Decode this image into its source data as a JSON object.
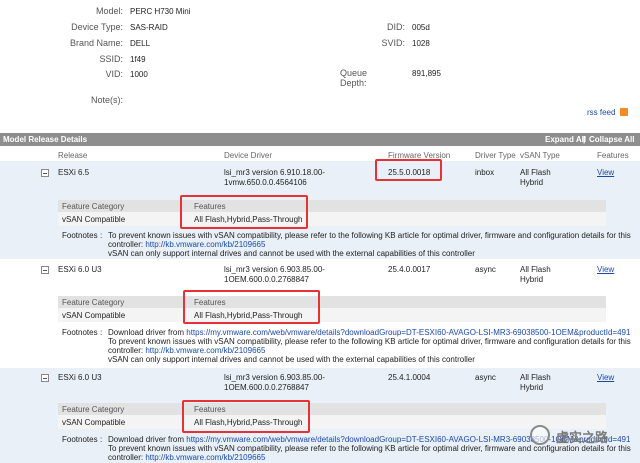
{
  "device": {
    "model_label": "Model:",
    "model": "PERC H730 Mini",
    "type_label": "Device Type:",
    "type": "SAS-RAID",
    "brand_label": "Brand Name:",
    "brand": "DELL",
    "ssid_label": "SSID:",
    "ssid": "1f49",
    "vid_label": "VID:",
    "vid": "1000",
    "notes_label": "Note(s):",
    "did_label": "DID:",
    "did": "005d",
    "svid_label": "SVID:",
    "svid": "1028",
    "queue_label_1": "Queue",
    "queue_label_2": "Depth:",
    "queue": "891,895",
    "rss": "rss feed"
  },
  "section": {
    "title": "Model Release Details",
    "expand_all": "Expand All",
    "separator": "|",
    "collapse_all": "Collapse All"
  },
  "columns": {
    "release": "Release",
    "driver": "Device Driver",
    "firmware": "Firmware Version",
    "driver_type": "Driver Type",
    "vsan_type": "vSAN Type",
    "features": "Features"
  },
  "releases": [
    {
      "release": "ESXi 6.5",
      "driver_1": "lsi_mr3 version 6.910.18.00-",
      "driver_2": "1vmw.650.0.0.4564106",
      "firmware": "25.5.0.0018",
      "driver_type": "inbox",
      "vsan_1": "All Flash",
      "vsan_2": "Hybrid",
      "view": "View",
      "feature_category_header": "Feature Category",
      "features_header": "Features",
      "feature_category": "vSAN Compatible",
      "features": "All Flash,Hybrid,Pass-Through",
      "footnotes_label": "Footnotes",
      "colon": ":",
      "fn_1": "To prevent known issues with vSAN compatibility, please refer to the following KB article for optimal driver, firmware and configuration details for this",
      "fn_2_pre": "controller: ",
      "fn_2_link": "http://kb.vmware.com/kb/2109665",
      "fn_3": "vSAN can only support internal drives and cannot be used with the external capabilities of this controller"
    },
    {
      "release": "ESXi 6.0 U3",
      "driver_1": "lsi_mr3 version 6.903.85.00-",
      "driver_2": "1OEM.600.0.0.2768847",
      "firmware": "25.4.0.0017",
      "driver_type": "async",
      "vsan_1": "All Flash",
      "vsan_2": "Hybrid",
      "view": "View",
      "feature_category_header": "Feature Category",
      "features_header": "Features",
      "feature_category": "vSAN Compatible",
      "features": "All Flash,Hybrid,Pass-Through",
      "footnotes_label": "Footnotes",
      "colon": ":",
      "fn_0_pre": "Download driver from ",
      "fn_0_link": "https://my.vmware.com/web/vmware/details?downloadGroup=DT-ESXI60-AVAGO-LSI-MR3-69038500-1OEM&productId=491",
      "fn_1": "To prevent known issues with vSAN compatibility, please refer to the following KB article for optimal driver, firmware and configuration details for this",
      "fn_2_pre": "controller: ",
      "fn_2_link": "http://kb.vmware.com/kb/2109665",
      "fn_3": "vSAN can only support internal drives and cannot be used with the external capabilities of this controller"
    },
    {
      "release": "ESXi 6.0 U3",
      "driver_1": "lsi_mr3 version 6.903.85.00-",
      "driver_2": "1OEM.600.0.0.2768847",
      "firmware": "25.4.1.0004",
      "driver_type": "async",
      "vsan_1": "All Flash",
      "vsan_2": "Hybrid",
      "view": "View",
      "feature_category_header": "Feature Category",
      "features_header": "Features",
      "feature_category": "vSAN Compatible",
      "features": "All Flash,Hybrid,Pass-Through",
      "footnotes_label": "Footnotes",
      "colon": ":",
      "fn_0_pre": "Download driver from ",
      "fn_0_link": "https://my.vmware.com/web/vmware/details?downloadGroup=DT-ESXI60-AVAGO-LSI-MR3-69038500-1OEM&productId=491",
      "fn_1": "To prevent known issues with vSAN compatibility, please refer to the following KB article for optimal driver, firmware and configuration details for this",
      "fn_2_pre": "controller: ",
      "fn_2_link": "http://kb.vmware.com/kb/2109665"
    }
  ],
  "watermark": "虚实之路"
}
